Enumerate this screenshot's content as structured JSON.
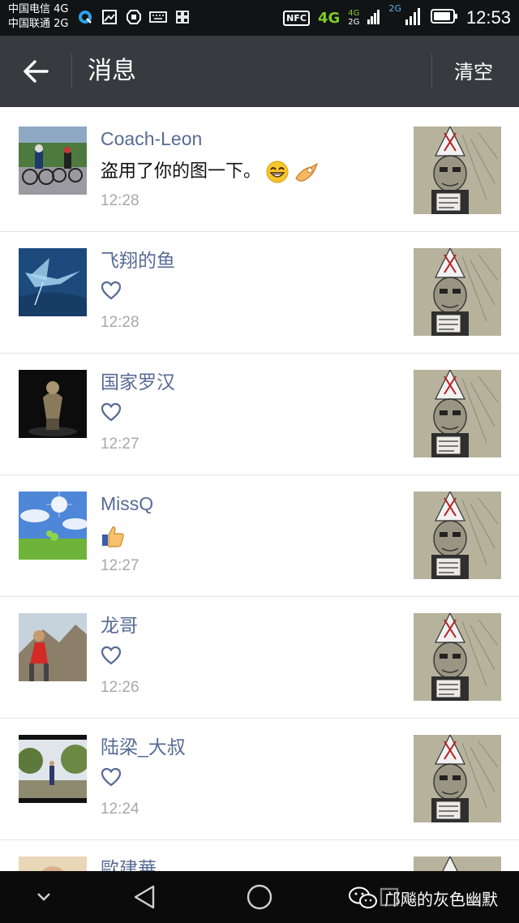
{
  "status_bar": {
    "carrier_1": "中国电信 4G",
    "carrier_2": "中国联通 2G",
    "nfc": "NFC",
    "net_4g": "4G",
    "net_4g_small": "4G",
    "net_2g_small": "2G",
    "net_2g_top": "2G",
    "time": "12:53"
  },
  "header": {
    "title": "消息",
    "clear_label": "清空"
  },
  "messages": [
    {
      "name": "Coach-Leon",
      "content_type": "comment",
      "comment": "盗用了你的图一下。",
      "emoji": [
        "grin-face-icon",
        "ok-hand-icon"
      ],
      "time": "12:28"
    },
    {
      "name": "飞翔的鱼",
      "content_type": "like",
      "icon": "heart-icon",
      "time": "12:28"
    },
    {
      "name": "国家罗汉",
      "content_type": "like",
      "icon": "heart-icon",
      "time": "12:27"
    },
    {
      "name": "MissQ",
      "content_type": "emoji",
      "icon": "thumbs-up-icon",
      "time": "12:27"
    },
    {
      "name": "龙哥",
      "content_type": "like",
      "icon": "heart-icon",
      "time": "12:26"
    },
    {
      "name": "陆梁_大叔",
      "content_type": "like",
      "icon": "heart-icon",
      "time": "12:24"
    },
    {
      "name": "歐建華",
      "content_type": "partial"
    }
  ],
  "nav_bar": {
    "icons": [
      "chevron-down-icon",
      "back-triangle-icon",
      "home-circle-icon",
      "recents-square-icon"
    ],
    "watermark": "邝飚的灰色幽默"
  },
  "colors": {
    "status_bar_bg": "#111315",
    "title_bar_bg": "#393a3f",
    "name_color": "#576b95",
    "time_color": "#a8a8a8",
    "nav_bar_bg": "#0b0b0c"
  }
}
